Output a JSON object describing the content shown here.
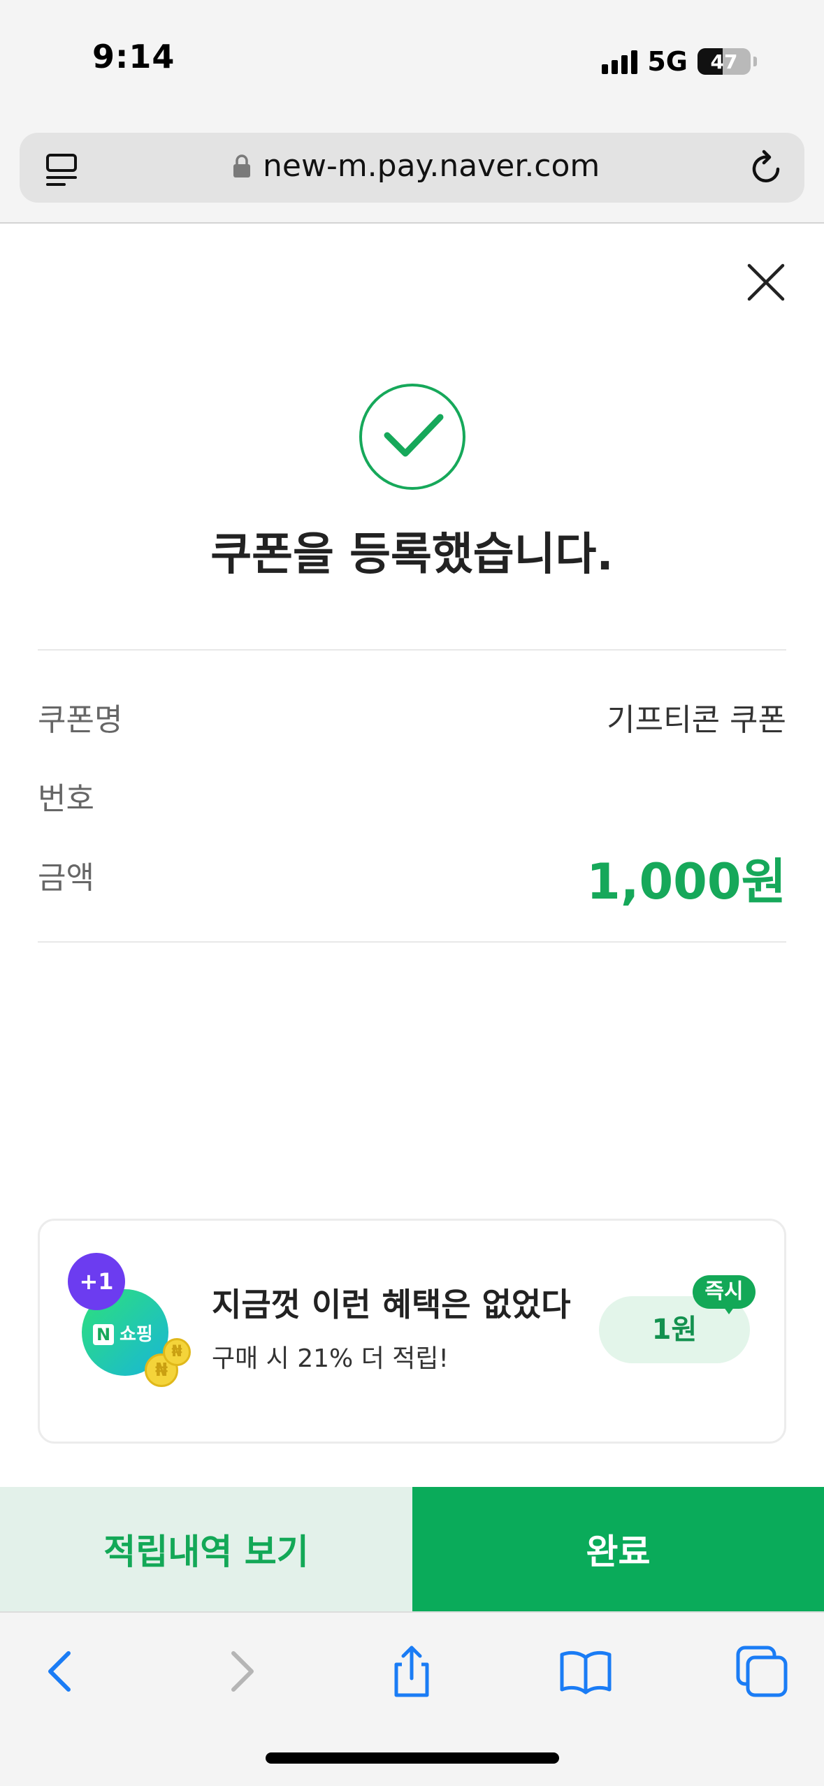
{
  "status_bar": {
    "time": "9:14",
    "network": "5G",
    "battery": "47",
    "battery_level": 0.47
  },
  "browser": {
    "url": "new-m.pay.naver.com"
  },
  "result": {
    "title": "쿠폰을 등록했습니다."
  },
  "details": {
    "coupon_name_label": "쿠폰명",
    "coupon_name_value": "기프티콘 쿠폰",
    "number_label": "번호",
    "amount_label": "금액",
    "amount_value": "1,000원"
  },
  "promo": {
    "badge_plus": "+1",
    "brand": "쇼핑",
    "brand_letter": "N",
    "coin_symbol": "₦",
    "title": "지금껏 이런 혜택은 없었다",
    "subtitle": "구매 시 21% 더 적립!",
    "pill": "1원",
    "instant": "즉시"
  },
  "buttons": {
    "history": "적립내역 보기",
    "done": "완료"
  },
  "colors": {
    "accent": "#16a85a",
    "done_bg": "#0aab5a",
    "history_bg": "#e3f1ea"
  }
}
